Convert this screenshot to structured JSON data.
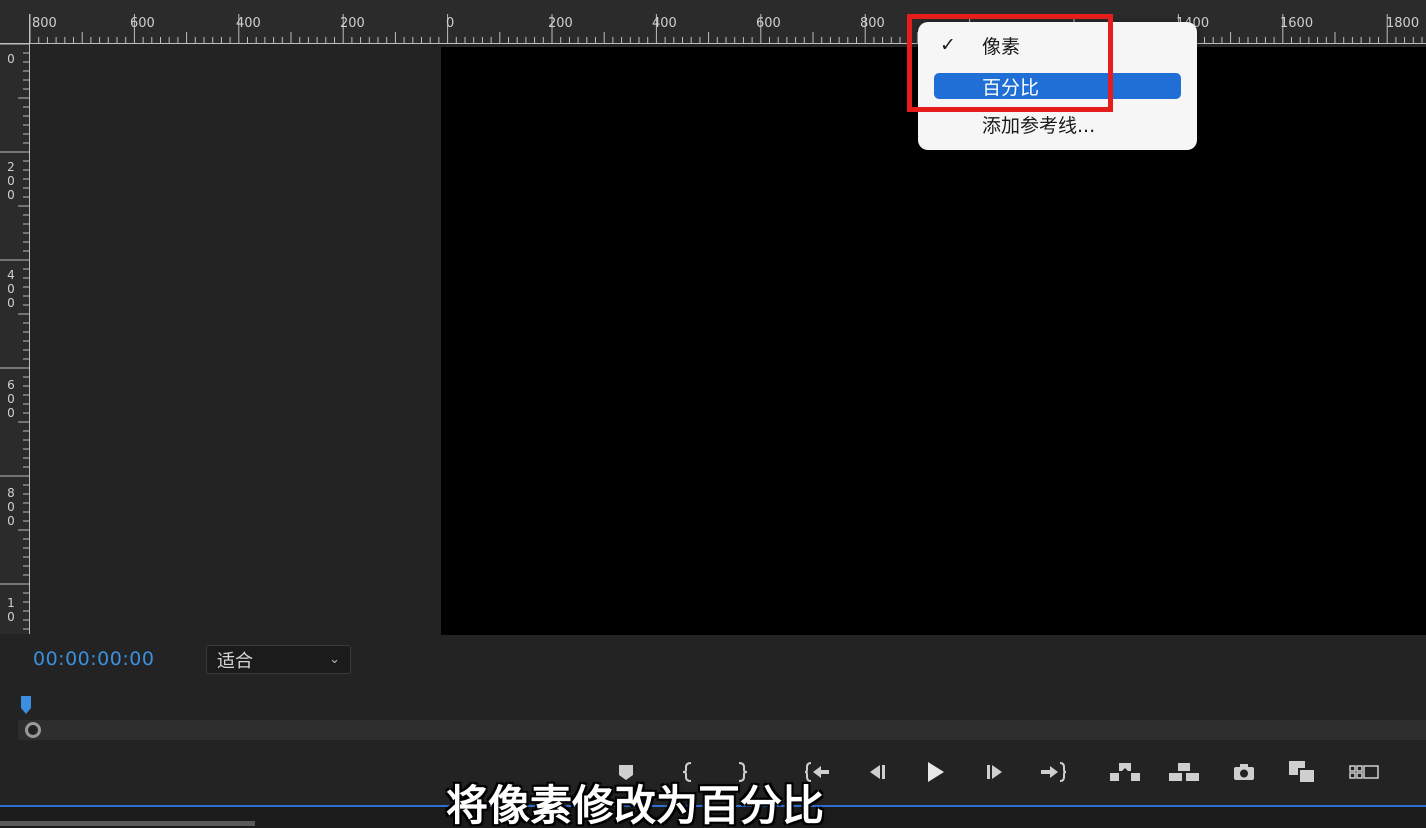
{
  "ruler_top": {
    "labels": [
      "800",
      "600",
      "400",
      "200",
      "0",
      "200",
      "400",
      "600",
      "800",
      "1400",
      "1600",
      "1800"
    ]
  },
  "ruler_left": {
    "labels": [
      "0",
      "2\n0\n0",
      "4\n0\n0",
      "6\n0\n0",
      "8\n0\n0",
      "1\n0"
    ]
  },
  "context_menu": {
    "items": [
      {
        "label": "像素",
        "checked": true
      },
      {
        "label": "百分比",
        "highlighted": true
      },
      {
        "label": "添加参考线..."
      }
    ]
  },
  "monitor": {
    "timecode": "00:00:00:00",
    "fit_select": {
      "value": "适合"
    }
  },
  "transport": {
    "buttons": [
      "add-marker-icon",
      "mark-in-icon",
      "mark-out-icon",
      "go-to-in-icon",
      "step-back-icon",
      "play-icon",
      "step-forward-icon",
      "go-to-out-icon",
      "lift-icon",
      "extract-icon",
      "export-frame-icon",
      "compare-view-icon",
      "button-editor-icon"
    ]
  },
  "subtitle": "将像素修改为百分比",
  "colors": {
    "accent": "#1f6fd6",
    "timecode": "#3b8fe0",
    "highlight": "#e61d1d",
    "background": "#232323"
  }
}
